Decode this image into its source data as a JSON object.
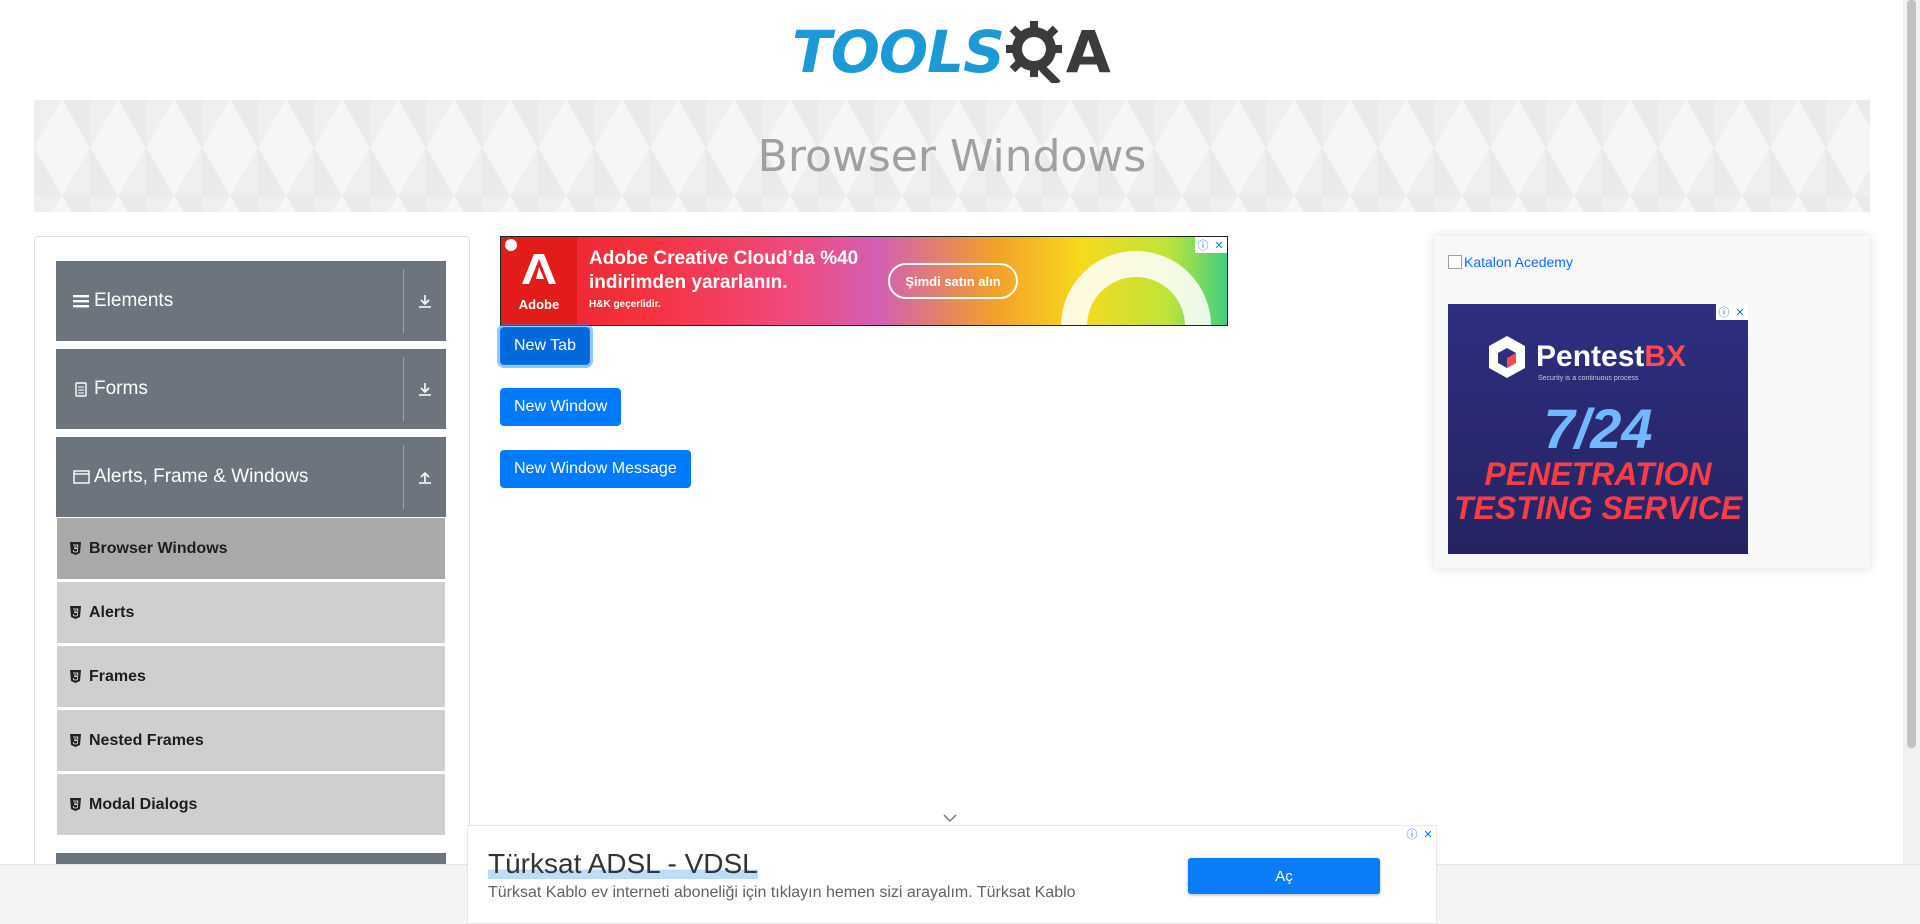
{
  "header": {
    "logo_tools": "TOOLS",
    "logo_a": "A",
    "page_title": "Browser Windows"
  },
  "sidebar": {
    "groups": [
      {
        "label": "Elements",
        "icon": "hamburger-icon",
        "arrow": "download-arrow-icon"
      },
      {
        "label": "Forms",
        "icon": "form-icon",
        "arrow": "download-arrow-icon"
      },
      {
        "label": "Alerts, Frame & Windows",
        "icon": "window-icon",
        "arrow": "upload-arrow-icon"
      }
    ],
    "items": [
      {
        "label": "Browser Windows",
        "active": true
      },
      {
        "label": "Alerts",
        "active": false
      },
      {
        "label": "Frames",
        "active": false
      },
      {
        "label": "Nested Frames",
        "active": false
      },
      {
        "label": "Modal Dialogs",
        "active": false
      }
    ]
  },
  "main": {
    "buttons": {
      "new_tab": "New Tab",
      "new_window": "New Window",
      "new_window_message": "New Window Message"
    }
  },
  "ads": {
    "adobe": {
      "logo_word": "Adobe",
      "headline_1": "Adobe Creative Cloud’da %40",
      "headline_2": "indirimden yararlanın.",
      "disclaimer": "H&K geçerlidir.",
      "cta": "Şimdi satın alın"
    },
    "katalon_alt": "Katalon Acedemy",
    "pentest": {
      "brand_1": "Pentest",
      "brand_2": "BX",
      "tagline": "Security is a continuous process",
      "big": "7/24",
      "line_1": "PENETRATION",
      "line_2": "TESTING SERVICE"
    },
    "turksat": {
      "title": "Türksat ADSL - VDSL",
      "description": "Türksat Kablo ev interneti aboneliği için tıklayın hemen sizi arayalım. Türksat Kablo",
      "cta": "Aç"
    }
  },
  "colors": {
    "primary": "#007bff",
    "sidebar_group": "#6c757d",
    "sidebar_item": "#cfcfcf",
    "sidebar_item_active": "#a9a9a9",
    "logo_blue": "#1d9ad6"
  }
}
